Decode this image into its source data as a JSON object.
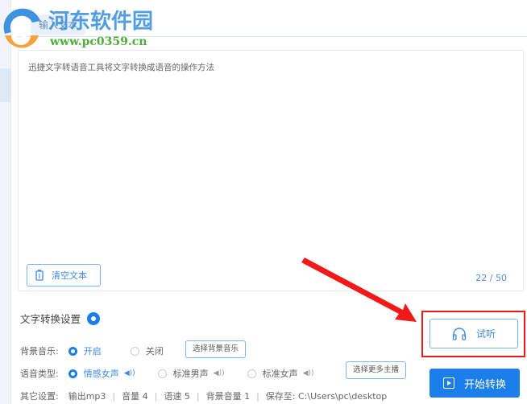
{
  "tab_label": "输入文本",
  "watermark": {
    "name": "河东软件园",
    "url": "www.pc0359.cn"
  },
  "editor": {
    "text": "迅捷文字转语音工具将文字转换成语音的操作方法",
    "clear_label": "清空文本",
    "counter": "22 / 50"
  },
  "settings": {
    "title": "文字转换设置",
    "bg_music": {
      "label": "背景音乐:",
      "options": [
        "开启",
        "关闭"
      ],
      "selected": "开启",
      "button": "选择背景音乐"
    },
    "voice_type": {
      "label": "语音类型:",
      "options": [
        "情感女声",
        "标准男声",
        "标准女声"
      ],
      "selected": "情感女声",
      "button": "选择更多主播"
    },
    "other": {
      "label": "其它设置:",
      "items": [
        "输出mp3",
        "音量 4",
        "语速 5",
        "背景音量 1",
        "保存至: C:\\Users\\pc\\desktop"
      ]
    }
  },
  "actions": {
    "listen": "试听",
    "start": "开始转换"
  },
  "colors": {
    "accent": "#1b7fe9",
    "highlight": "#f01a1a"
  }
}
